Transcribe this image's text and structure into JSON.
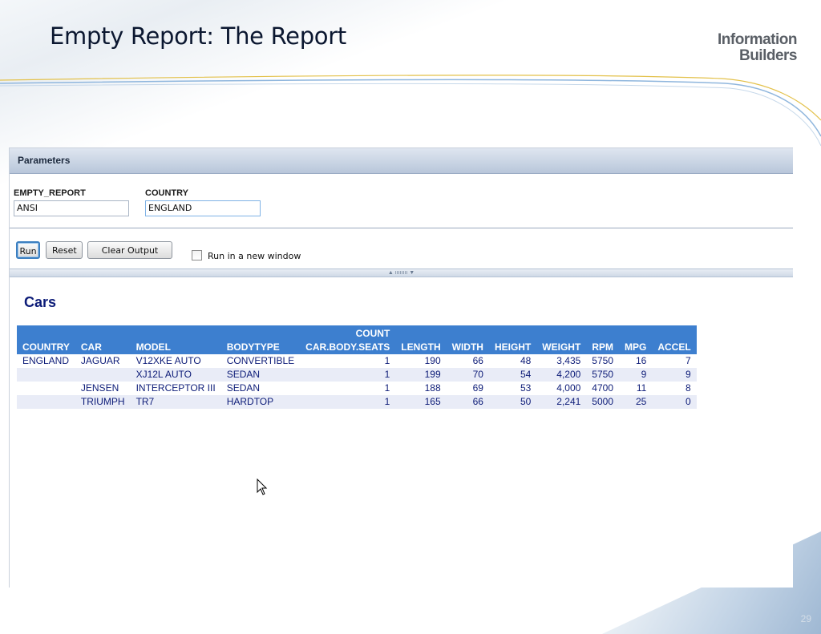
{
  "slide": {
    "title": "Empty Report: The Report",
    "logo_line1": "Information",
    "logo_line2": "Builders",
    "page_number": "29"
  },
  "parameters_panel": {
    "header": "Parameters",
    "fields": [
      {
        "label": "EMPTY_REPORT",
        "value": "ANSI"
      },
      {
        "label": "COUNTRY",
        "value": "ENGLAND"
      }
    ],
    "buttons": {
      "run": "Run",
      "reset": "Reset",
      "clear_output": "Clear Output"
    },
    "new_window_label": "Run in a new window",
    "new_window_checked": false,
    "splitter_glyph": "▲ ıııııııı ▼"
  },
  "report": {
    "title": "Cars",
    "header_group": "COUNT",
    "columns": [
      "COUNTRY",
      "CAR",
      "MODEL",
      "BODYTYPE",
      "CAR.BODY.SEATS",
      "LENGTH",
      "WIDTH",
      "HEIGHT",
      "WEIGHT",
      "RPM",
      "MPG",
      "ACCEL"
    ],
    "rows": [
      [
        "ENGLAND",
        "JAGUAR",
        "V12XKE AUTO",
        "CONVERTIBLE",
        "1",
        "190",
        "66",
        "48",
        "3,435",
        "5750",
        "16",
        "7"
      ],
      [
        "",
        "",
        "XJ12L AUTO",
        "SEDAN",
        "1",
        "199",
        "70",
        "54",
        "4,200",
        "5750",
        "9",
        "9"
      ],
      [
        "",
        "JENSEN",
        "INTERCEPTOR III",
        "SEDAN",
        "1",
        "188",
        "69",
        "53",
        "4,000",
        "4700",
        "11",
        "8"
      ],
      [
        "",
        "TRIUMPH",
        "TR7",
        "HARDTOP",
        "1",
        "165",
        "66",
        "50",
        "2,241",
        "5000",
        "25",
        "0"
      ]
    ]
  },
  "colors": {
    "header_blue": "#3d7fcf",
    "report_text": "#0d1c78",
    "alt_row": "#e9ecf7"
  }
}
